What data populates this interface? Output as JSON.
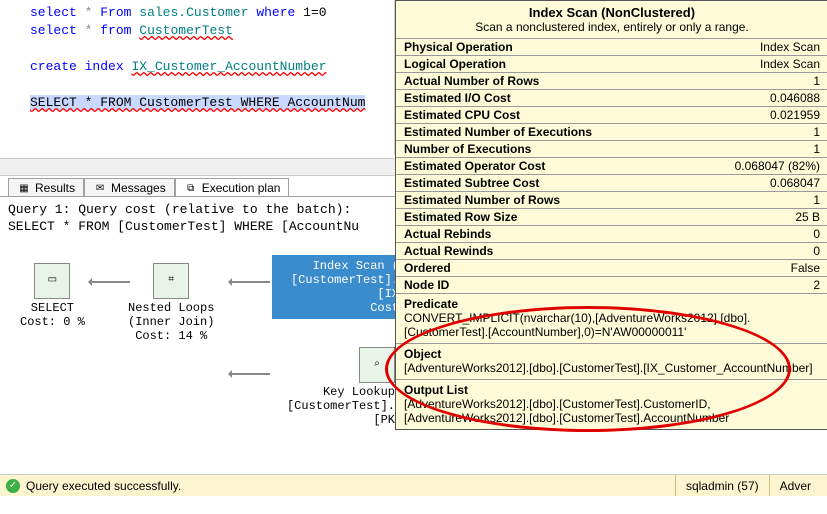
{
  "editor": {
    "line1_kw1": "select",
    "line1_star": "*",
    "line1_kw2": "From",
    "line1_id": "sales.Customer",
    "line1_kw3": "where",
    "line1_cond": "1=0",
    "line2_kw1": "select",
    "line2_star": "*",
    "line2_kw2": "from",
    "line2_id": "CustomerTest",
    "line3_kw1": "create",
    "line3_kw2": "index",
    "line3_id1": "IX_Customer_AccountNumber",
    "line4": "SELECT * FROM CustomerTest WHERE AccountNum"
  },
  "tabs": {
    "results": "Results",
    "messages": "Messages",
    "plan": "Execution plan"
  },
  "plan": {
    "header1": "Query 1: Query cost (relative to the batch):",
    "header2": "SELECT * FROM [CustomerTest] WHERE [AccountNu",
    "select_label": "SELECT",
    "select_cost": "Cost: 0 %",
    "nested_label1": "Nested Loops",
    "nested_label2": "(Inner Join)",
    "nested_cost": "Cost: 14 %",
    "scan_label1": "Index Scan (",
    "scan_label2": "[CustomerTest].[IX",
    "scan_cost": "Cost",
    "lookup_label1": "Key Lookup",
    "lookup_label2": "[CustomerTest].[PK"
  },
  "tooltip": {
    "title": "Index Scan (NonClustered)",
    "subtitle": "Scan a nonclustered index, entirely or only a range.",
    "rows": [
      {
        "k": "Physical Operation",
        "v": "Index Scan"
      },
      {
        "k": "Logical Operation",
        "v": "Index Scan"
      },
      {
        "k": "Actual Number of Rows",
        "v": "1"
      },
      {
        "k": "Estimated I/O Cost",
        "v": "0.046088"
      },
      {
        "k": "Estimated CPU Cost",
        "v": "0.021959"
      },
      {
        "k": "Estimated Number of Executions",
        "v": "1"
      },
      {
        "k": "Number of Executions",
        "v": "1"
      },
      {
        "k": "Estimated Operator Cost",
        "v": "0.068047 (82%)"
      },
      {
        "k": "Estimated Subtree Cost",
        "v": "0.068047"
      },
      {
        "k": "Estimated Number of Rows",
        "v": "1"
      },
      {
        "k": "Estimated Row Size",
        "v": "25 B"
      },
      {
        "k": "Actual Rebinds",
        "v": "0"
      },
      {
        "k": "Actual Rewinds",
        "v": "0"
      },
      {
        "k": "Ordered",
        "v": "False"
      },
      {
        "k": "Node ID",
        "v": "2"
      }
    ],
    "predicate_label": "Predicate",
    "predicate_text": "CONVERT_IMPLICIT(nvarchar(10),[AdventureWorks2012].[dbo].[CustomerTest].[AccountNumber],0)=N'AW00000011'",
    "object_label": "Object",
    "object_text": "[AdventureWorks2012].[dbo].[CustomerTest].[IX_Customer_AccountNumber]",
    "output_label": "Output List",
    "output_text": "[AdventureWorks2012].[dbo].[CustomerTest].CustomerID, [AdventureWorks2012].[dbo].[CustomerTest].AccountNumber"
  },
  "statusbar": {
    "message": "Query executed successfully.",
    "user": "sqladmin (57)",
    "db": "Adver"
  }
}
